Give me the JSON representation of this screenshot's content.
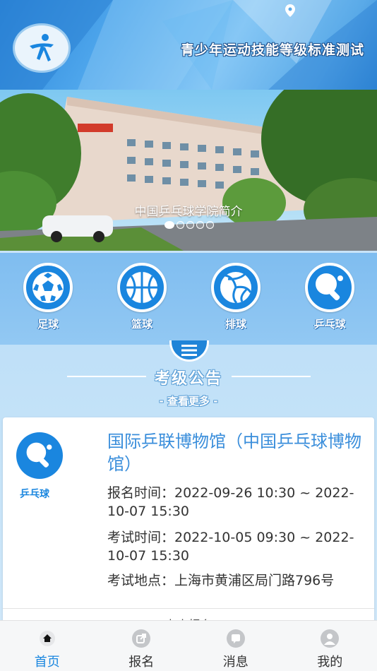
{
  "header": {
    "app_title": "青少年运动技能等级标准测试"
  },
  "banner": {
    "caption": "中国乒乓球学院简介",
    "slide_count": 5,
    "active_slide": 1
  },
  "categories": [
    {
      "label": "足球",
      "icon": "soccer-ball-icon"
    },
    {
      "label": "篮球",
      "icon": "basketball-icon"
    },
    {
      "label": "排球",
      "icon": "volleyball-icon"
    },
    {
      "label": "乒乓球",
      "icon": "table-tennis-icon"
    }
  ],
  "notice": {
    "section_title": "考级公告",
    "more_link": "- 查看更多 -",
    "card": {
      "sport_label": "乒乓球",
      "title": "国际乒联博物馆（中国乒乓球博物馆）",
      "register_time": "报名时间：2022-09-26 10:30 ~ 2022-10-07 15:30",
      "exam_time": "考试时间：2022-10-05 09:30 ~ 2022-10-07 15:30",
      "exam_location": "考试地点：上海市黄浦区局门路796号",
      "action_label": "点击报名"
    }
  },
  "bottom_nav": [
    {
      "label": "首页",
      "icon": "home-icon",
      "active": true
    },
    {
      "label": "报名",
      "icon": "share-icon",
      "active": false
    },
    {
      "label": "消息",
      "icon": "message-icon",
      "active": false
    },
    {
      "label": "我的",
      "icon": "profile-icon",
      "active": false
    }
  ],
  "colors": {
    "primary": "#1a86df",
    "header_blue": "#4ea6ec",
    "page_bg": "#c8e3f8"
  }
}
